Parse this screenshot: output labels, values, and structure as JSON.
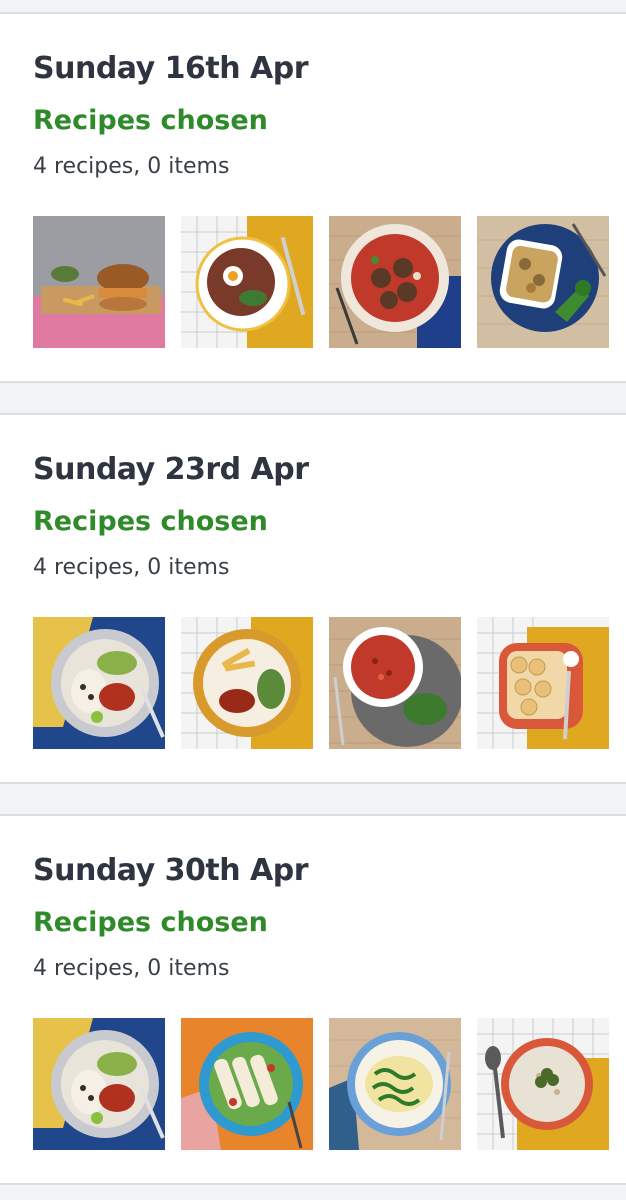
{
  "weeks": [
    {
      "date": "Sunday 16th Apr",
      "status": "Recipes chosen",
      "counts": "4 recipes, 0 items",
      "recipes": [
        {
          "icon": "burger-fries-photo",
          "bg": "#9b9da3",
          "accent": "#e07aa0"
        },
        {
          "icon": "egg-salad-plate-photo",
          "bg": "#e0a820",
          "accent": "#ffffff"
        },
        {
          "icon": "meatballs-bowl-photo",
          "bg": "#c9ad8c",
          "accent": "#c0392b"
        },
        {
          "icon": "pasta-bake-broccoli-photo",
          "bg": "#d2bfa3",
          "accent": "#1f3f7a"
        }
      ]
    },
    {
      "date": "Sunday 23rd Apr",
      "status": "Recipes chosen",
      "counts": "4 recipes, 0 items",
      "recipes": [
        {
          "icon": "chicken-rice-plate-photo",
          "bg": "#20468c",
          "accent": "#e6c24a"
        },
        {
          "icon": "chips-chicken-plate-photo",
          "bg": "#e0a820",
          "accent": "#d89a2a"
        },
        {
          "icon": "stew-bowl-photo",
          "bg": "#c9ad8c",
          "accent": "#c0392b"
        },
        {
          "icon": "potato-bake-dish-photo",
          "bg": "#e0a820",
          "accent": "#d9583a"
        }
      ]
    },
    {
      "date": "Sunday 30th Apr",
      "status": "Recipes chosen",
      "counts": "4 recipes, 0 items",
      "recipes": [
        {
          "icon": "chicken-rice-plate-photo",
          "bg": "#20468c",
          "accent": "#e6c24a"
        },
        {
          "icon": "wraps-salad-plate-photo",
          "bg": "#e8842c",
          "accent": "#2e9ad0"
        },
        {
          "icon": "spinach-pasta-plate-photo",
          "bg": "#d4b89a",
          "accent": "#f1e3a0"
        },
        {
          "icon": "risotto-bowl-photo",
          "bg": "#e0a820",
          "accent": "#e0e0e0"
        }
      ]
    }
  ]
}
